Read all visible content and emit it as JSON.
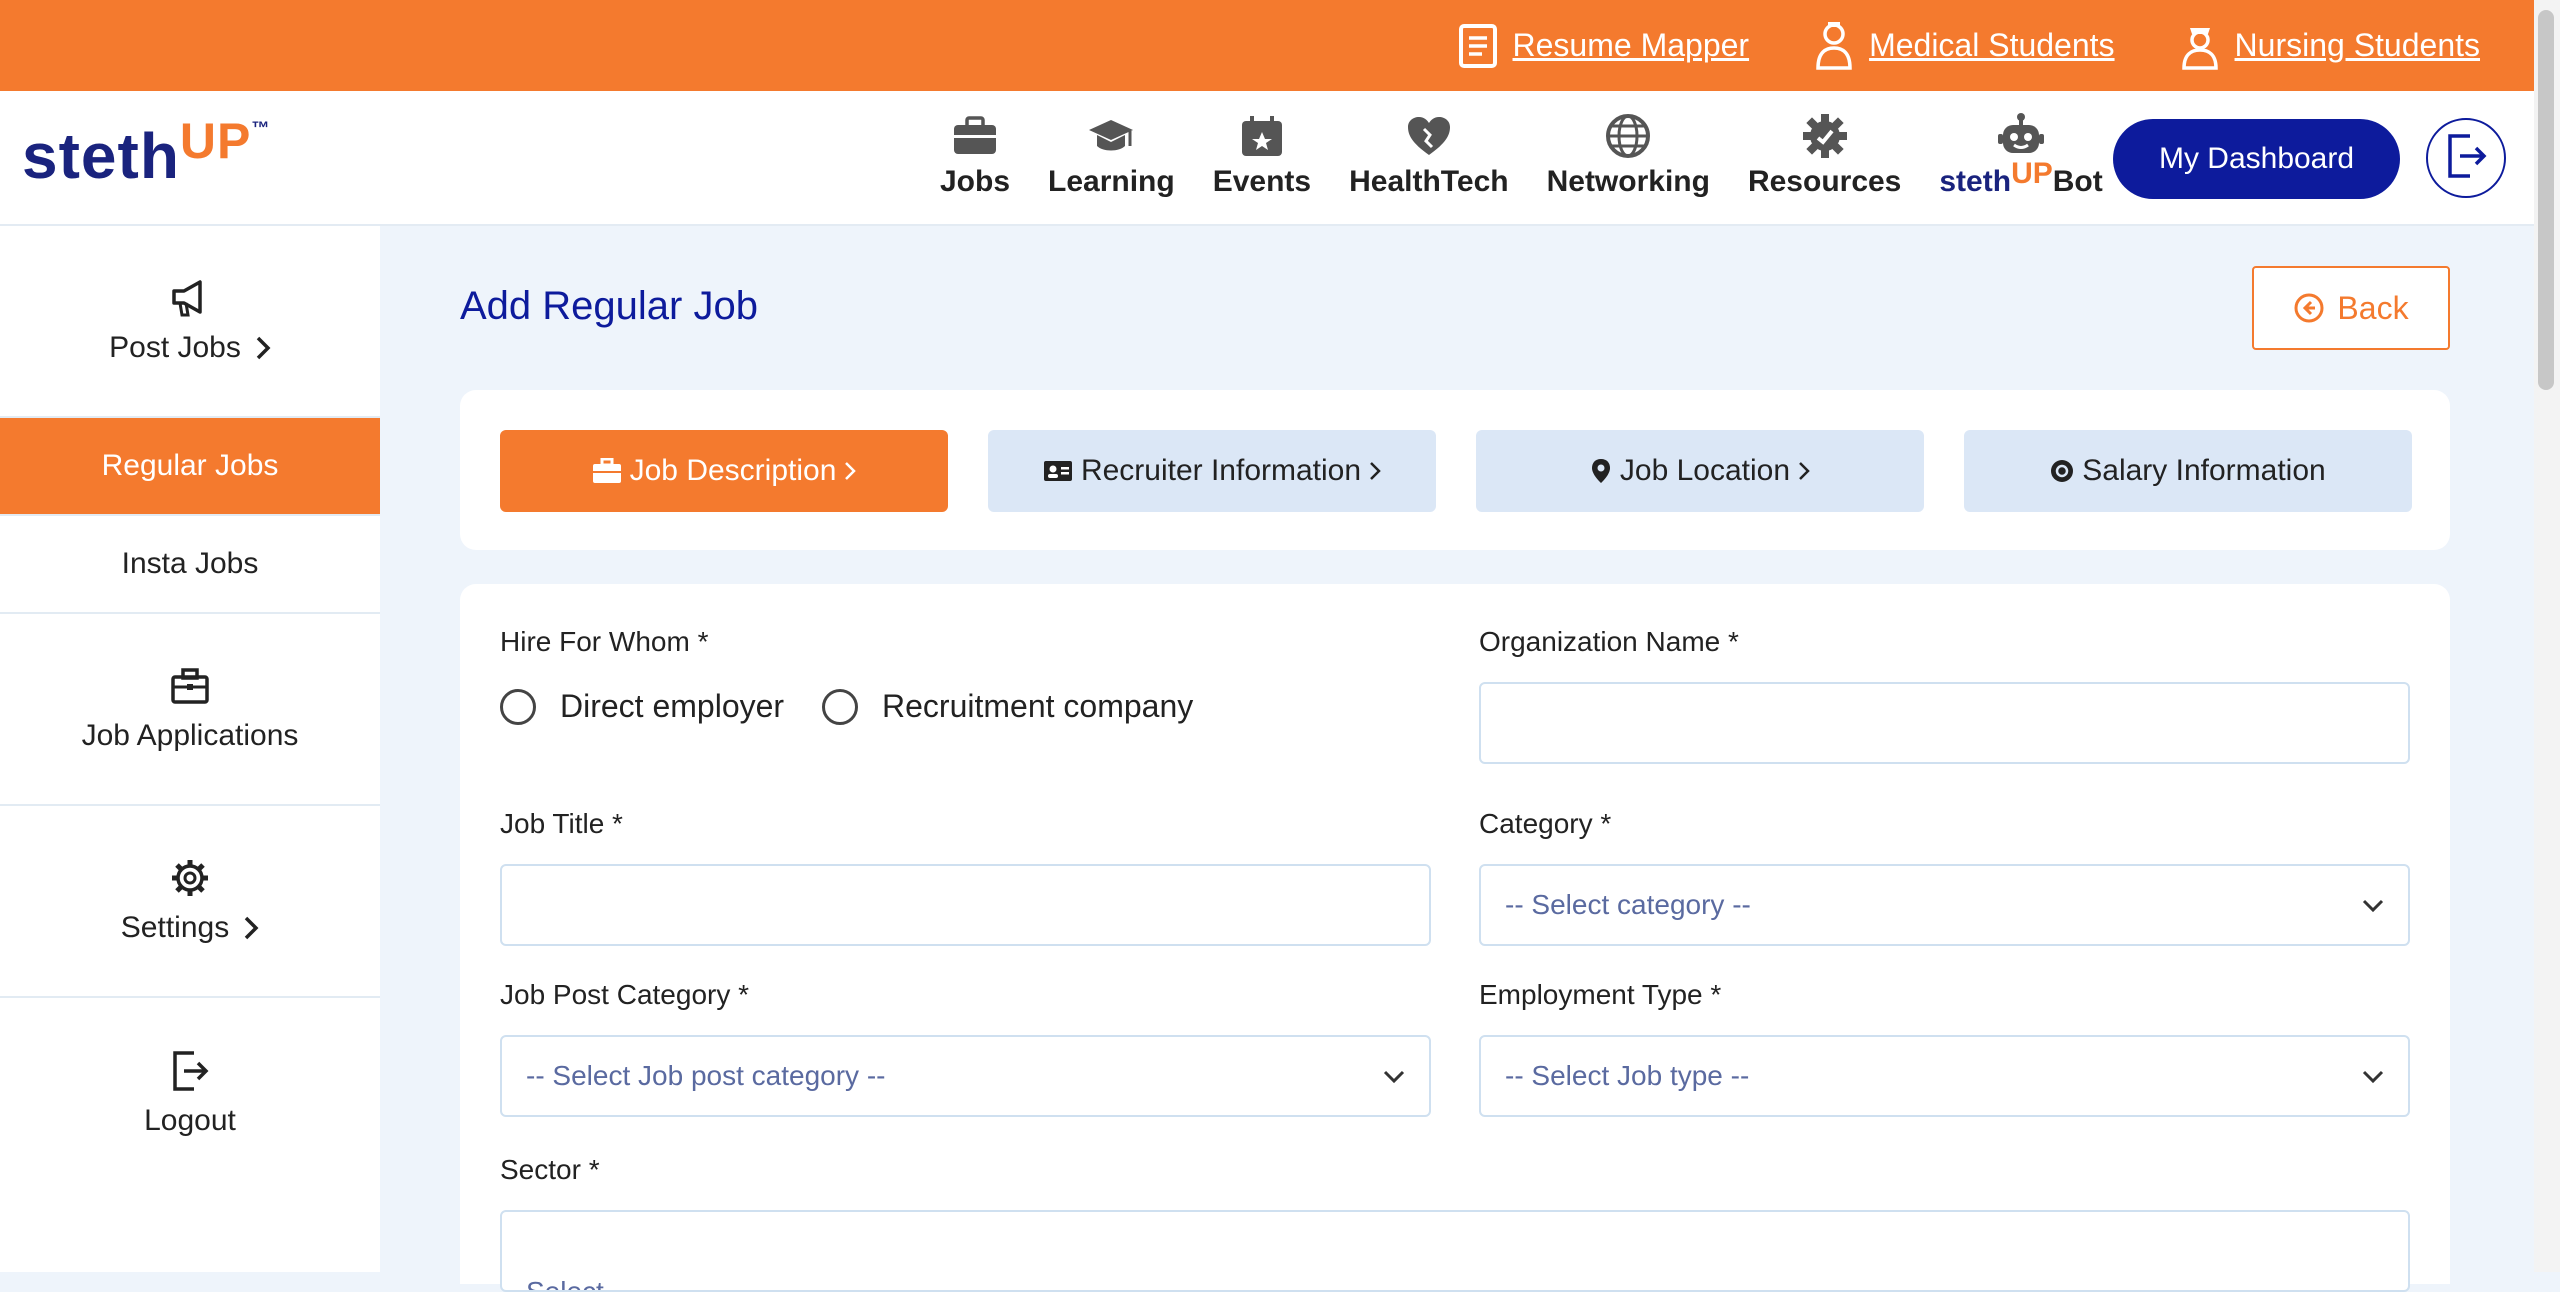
{
  "topbar": {
    "links": [
      {
        "label": "Resume Mapper",
        "icon": "document-icon"
      },
      {
        "label": "Medical Students",
        "icon": "doctor-icon"
      },
      {
        "label": "Nursing Students",
        "icon": "nurse-icon"
      }
    ]
  },
  "header": {
    "logo_text": "steth",
    "logo_up": "UP",
    "logo_tm": "™",
    "nav": [
      {
        "label": "Jobs",
        "icon": "briefcase-icon"
      },
      {
        "label": "Learning",
        "icon": "graduation-cap-icon"
      },
      {
        "label": "Events",
        "icon": "calendar-star-icon"
      },
      {
        "label": "HealthTech",
        "icon": "heart-icon"
      },
      {
        "label": "Networking",
        "icon": "globe-icon"
      },
      {
        "label": "Resources",
        "icon": "gear-icon"
      }
    ],
    "bot": {
      "part1": "steth",
      "part2": "UP",
      "part3": "Bot",
      "icon": "robot-icon"
    },
    "dashboard_label": "My Dashboard"
  },
  "sidebar": {
    "items": [
      {
        "label": "Post Jobs",
        "icon": "megaphone-icon"
      },
      {
        "label": "Regular Jobs"
      },
      {
        "label": "Insta Jobs"
      },
      {
        "label": "Job Applications",
        "icon": "briefcase-icon"
      },
      {
        "label": "Settings",
        "icon": "gear-icon"
      },
      {
        "label": "Logout",
        "icon": "logout-icon"
      }
    ]
  },
  "main": {
    "title": "Add Regular Job",
    "back_label": "Back",
    "tabs": [
      {
        "label": "Job Description",
        "icon": "briefcase-icon"
      },
      {
        "label": "Recruiter Information",
        "icon": "id-card-icon"
      },
      {
        "label": "Job Location",
        "icon": "location-pin-icon"
      },
      {
        "label": "Salary Information",
        "icon": "coin-icon"
      }
    ],
    "form": {
      "hire_label": "Hire For Whom *",
      "hire_options": [
        "Direct employer",
        "Recruitment company"
      ],
      "org_label": "Organization Name *",
      "org_value": "",
      "job_title_label": "Job Title *",
      "job_title_value": "",
      "category_label": "Category *",
      "category_placeholder": "-- Select category --",
      "job_post_cat_label": "Job Post Category *",
      "job_post_cat_placeholder": "-- Select Job post category --",
      "employment_type_label": "Employment Type *",
      "employment_type_placeholder": "-- Select Job type --",
      "sector_label": "Sector *",
      "sector_placeholder": "Select"
    }
  },
  "colors": {
    "accent": "#f47a2e",
    "navy": "#0d1b9c",
    "bg": "#eef4fb"
  }
}
